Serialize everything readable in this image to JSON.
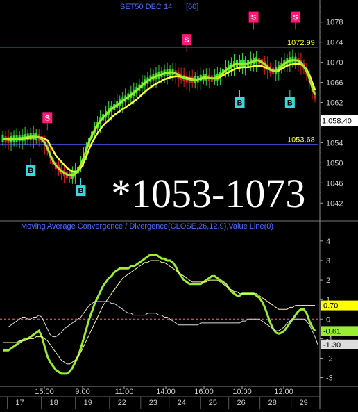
{
  "chart_data": [
    {
      "type": "line",
      "title": "SET50 DEC 14",
      "interval": "[60]",
      "ylim": [
        1039,
        1081
      ],
      "yticks": [
        1042,
        1046,
        1050,
        1054,
        1058,
        1062,
        1066,
        1070,
        1074,
        1078
      ],
      "grid": false,
      "annotation_text": "*1053-1073",
      "reference_lines": [
        {
          "value": 1072.99,
          "label": "1072.99",
          "color": "#4d5bff"
        },
        {
          "value": 1053.68,
          "label": "1053.68",
          "color": "#4d5bff"
        }
      ],
      "last_price": {
        "value": 1058.4,
        "label": "1,058.40"
      },
      "signals": [
        {
          "type": "buy",
          "label": "B",
          "bar": 10,
          "price": 1051.0
        },
        {
          "type": "sell",
          "label": "S",
          "bar": 16,
          "price": 1056.5
        },
        {
          "type": "buy",
          "label": "B",
          "bar": 28,
          "price": 1047.0
        },
        {
          "type": "sell",
          "label": "S",
          "bar": 66,
          "price": 1072.0
        },
        {
          "type": "buy",
          "label": "B",
          "bar": 85,
          "price": 1064.5
        },
        {
          "type": "sell",
          "label": "S",
          "bar": 90,
          "price": 1076.5
        },
        {
          "type": "buy",
          "label": "B",
          "bar": 103,
          "price": 1064.5
        },
        {
          "type": "sell",
          "label": "S",
          "bar": 105,
          "price": 1076.5
        }
      ],
      "series": [
        {
          "name": "",
          "color": "#ffff33",
          "values": [
            1054.8,
            1054.8,
            1054.7,
            1054.7,
            1054.7,
            1054.8,
            1054.8,
            1054.8,
            1054.9,
            1054.9,
            1055.0,
            1055.0,
            1055.1,
            1055.1,
            1055.0,
            1054.8,
            1054.5,
            1053.5,
            1052.5,
            1051.5,
            1050.8,
            1050.2,
            1049.6,
            1049.0,
            1048.6,
            1048.3,
            1048.2,
            1048.4,
            1049.0,
            1050.0,
            1051.3,
            1052.8,
            1054.0,
            1055.0,
            1055.9,
            1056.7,
            1057.4,
            1058.0,
            1058.5,
            1059.0,
            1059.5,
            1059.9,
            1060.3,
            1060.7,
            1061.0,
            1061.4,
            1061.8,
            1062.2,
            1062.6,
            1063.1,
            1063.6,
            1064.1,
            1064.6,
            1065.0,
            1065.4,
            1065.7,
            1066.0,
            1066.3,
            1066.6,
            1066.8,
            1067.0,
            1067.1,
            1067.2,
            1067.2,
            1067.1,
            1067.0,
            1066.9,
            1066.8,
            1066.7,
            1066.6,
            1066.6,
            1066.7,
            1066.8,
            1066.8,
            1066.8,
            1066.8,
            1066.8,
            1066.9,
            1067.1,
            1067.4,
            1067.7,
            1068.0,
            1068.3,
            1068.6,
            1068.8,
            1068.9,
            1069.0,
            1069.0,
            1069.0,
            1069.1,
            1069.2,
            1069.3,
            1069.3,
            1069.2,
            1069.0,
            1068.8,
            1068.5,
            1068.3,
            1068.2,
            1068.4,
            1068.7,
            1069.0,
            1069.3,
            1069.5,
            1069.6,
            1069.7,
            1069.7,
            1069.6,
            1069.2,
            1068.6,
            1067.5,
            1066.0,
            1064.5
          ]
        },
        {
          "name": "",
          "color": "#99ee33",
          "values": [
            1054.8,
            1054.7,
            1054.6,
            1054.6,
            1054.7,
            1054.8,
            1054.9,
            1054.9,
            1055.0,
            1055.1,
            1055.2,
            1055.2,
            1055.2,
            1055.1,
            1054.7,
            1054.0,
            1053.0,
            1051.6,
            1050.4,
            1049.5,
            1048.9,
            1048.4,
            1048.0,
            1047.7,
            1047.5,
            1047.5,
            1047.8,
            1048.5,
            1049.6,
            1051.0,
            1052.6,
            1054.2,
            1055.5,
            1056.6,
            1057.5,
            1058.3,
            1059.0,
            1059.6,
            1060.2,
            1060.7,
            1061.1,
            1061.5,
            1061.9,
            1062.3,
            1062.7,
            1063.1,
            1063.5,
            1063.9,
            1064.4,
            1064.9,
            1065.4,
            1065.9,
            1066.3,
            1066.7,
            1067.0,
            1067.2,
            1067.4,
            1067.6,
            1067.8,
            1067.9,
            1068.0,
            1068.0,
            1067.8,
            1067.5,
            1067.2,
            1066.9,
            1066.7,
            1066.6,
            1066.5,
            1066.5,
            1066.6,
            1066.8,
            1067.0,
            1067.0,
            1066.9,
            1066.8,
            1066.8,
            1067.0,
            1067.4,
            1067.9,
            1068.4,
            1068.8,
            1069.2,
            1069.5,
            1069.7,
            1069.7,
            1069.7,
            1069.7,
            1069.8,
            1070.0,
            1070.2,
            1070.4,
            1070.3,
            1070.0,
            1069.6,
            1069.1,
            1068.6,
            1068.3,
            1068.3,
            1068.7,
            1069.2,
            1069.7,
            1070.1,
            1070.3,
            1070.4,
            1070.4,
            1070.3,
            1069.9,
            1069.2,
            1068.2,
            1066.8,
            1065.0,
            1063.5
          ]
        }
      ]
    },
    {
      "type": "line",
      "title": "Moving Average Convergence / Divergence(CLOSE,26,12,9),Value Line(0)",
      "ylim": [
        -3.3,
        4.6
      ],
      "yticks": [
        -3,
        -2,
        -1,
        0,
        1,
        2,
        3,
        4
      ],
      "zero_line": 0,
      "value_labels": [
        {
          "value": 0.7,
          "label": "0.70",
          "bg": "#ffff00",
          "fg": "#000000"
        },
        {
          "value": -0.61,
          "label": "-0.61",
          "bg": "#99ee33",
          "fg": "#000000"
        },
        {
          "value": -1.3,
          "label": "-1.30",
          "bg": "#dddddd",
          "fg": "#000000"
        }
      ],
      "series": [
        {
          "name": "",
          "color": "#99ee33",
          "values": [
            -1.6,
            -1.6,
            -1.6,
            -1.5,
            -1.4,
            -1.3,
            -1.2,
            -1.1,
            -1.0,
            -1.0,
            -0.9,
            -0.8,
            -0.7,
            -0.6,
            -0.9,
            -1.4,
            -1.9,
            -2.2,
            -2.4,
            -2.6,
            -2.7,
            -2.8,
            -2.8,
            -2.8,
            -2.7,
            -2.5,
            -2.2,
            -1.9,
            -1.5,
            -1.0,
            -0.5,
            0.0,
            0.4,
            0.8,
            1.1,
            1.4,
            1.7,
            1.9,
            2.1,
            2.2,
            2.4,
            2.5,
            2.6,
            2.6,
            2.6,
            2.6,
            2.7,
            2.7,
            2.8,
            2.9,
            3.0,
            3.1,
            3.2,
            3.3,
            3.3,
            3.3,
            3.2,
            3.1,
            3.1,
            3.0,
            3.0,
            2.9,
            2.7,
            2.4,
            2.2,
            2.0,
            1.9,
            1.8,
            1.8,
            1.8,
            1.8,
            1.8,
            1.9,
            2.0,
            2.1,
            2.2,
            2.2,
            2.1,
            2.0,
            1.9,
            1.8,
            1.6,
            1.4,
            1.3,
            1.2,
            1.2,
            1.3,
            1.3,
            1.3,
            1.3,
            1.3,
            1.2,
            1.1,
            0.9,
            0.6,
            0.2,
            -0.2,
            -0.5,
            -0.7,
            -0.75,
            -0.7,
            -0.6,
            -0.4,
            -0.2,
            0.0,
            0.2,
            0.4,
            0.5,
            0.5,
            0.3,
            -0.1,
            -0.4,
            -0.61
          ]
        },
        {
          "name": "",
          "color": "#ffff99",
          "values": [
            -1.2,
            -1.2,
            -1.2,
            -1.2,
            -1.2,
            -1.2,
            -1.1,
            -1.1,
            -1.1,
            -1.0,
            -1.0,
            -1.0,
            -0.9,
            -0.9,
            -0.9,
            -1.0,
            -1.1,
            -1.3,
            -1.5,
            -1.7,
            -1.9,
            -2.1,
            -2.2,
            -2.3,
            -2.3,
            -2.2,
            -2.1,
            -1.9,
            -1.7,
            -1.4,
            -1.1,
            -0.8,
            -0.5,
            -0.2,
            0.1,
            0.4,
            0.7,
            0.9,
            1.1,
            1.3,
            1.5,
            1.7,
            1.9,
            2.1,
            2.2,
            2.3,
            2.4,
            2.5,
            2.6,
            2.7,
            2.8,
            2.9,
            2.9,
            3.0,
            3.0,
            3.0,
            3.0,
            2.9,
            2.9,
            2.8,
            2.7,
            2.6,
            2.5,
            2.4,
            2.3,
            2.2,
            2.1,
            2.0,
            1.9,
            1.9,
            1.9,
            1.9,
            1.9,
            1.9,
            2.0,
            2.0,
            2.0,
            2.0,
            1.9,
            1.8,
            1.7,
            1.6,
            1.5,
            1.4,
            1.4,
            1.3,
            1.3,
            1.3,
            1.3,
            1.3,
            1.3,
            1.3,
            1.2,
            1.1,
            1.0,
            0.9,
            0.8,
            0.7,
            0.6,
            0.5,
            0.5,
            0.5,
            0.5,
            0.6,
            0.6,
            0.7,
            0.7,
            0.7,
            0.7,
            0.7,
            0.7,
            0.7,
            0.7
          ]
        },
        {
          "name": "",
          "color": "#dddddd",
          "values": [
            -0.4,
            -0.4,
            -0.4,
            -0.3,
            -0.2,
            -0.1,
            0.0,
            0.1,
            0.1,
            0.0,
            0.0,
            0.1,
            0.1,
            0.2,
            0.1,
            -0.2,
            -0.5,
            -0.8,
            -0.9,
            -0.9,
            -0.8,
            -0.7,
            -0.5,
            -0.4,
            -0.3,
            -0.2,
            -0.1,
            0.0,
            0.1,
            0.3,
            0.5,
            0.7,
            0.8,
            0.9,
            0.9,
            0.9,
            0.9,
            0.9,
            0.9,
            0.8,
            0.8,
            0.7,
            0.6,
            0.5,
            0.4,
            0.3,
            0.3,
            0.2,
            0.2,
            0.2,
            0.2,
            0.2,
            0.3,
            0.3,
            0.3,
            0.3,
            0.2,
            0.2,
            0.1,
            0.1,
            0.0,
            -0.1,
            -0.2,
            -0.3,
            -0.3,
            -0.3,
            -0.3,
            -0.3,
            -0.3,
            -0.3,
            -0.3,
            -0.2,
            -0.2,
            -0.2,
            -0.2,
            -0.2,
            -0.2,
            -0.2,
            -0.2,
            -0.2,
            -0.2,
            -0.2,
            -0.2,
            -0.2,
            -0.2,
            -0.2,
            -0.1,
            -0.1,
            0.0,
            0.0,
            0.0,
            0.0,
            0.0,
            -0.1,
            -0.2,
            -0.3,
            -0.4,
            -0.5,
            -0.6,
            -0.6,
            -0.5,
            -0.4,
            -0.2,
            -0.1,
            0.0,
            0.0,
            0.0,
            0.0,
            0.0,
            -0.1,
            -0.3,
            -0.6,
            -0.9,
            -1.3
          ]
        }
      ]
    }
  ],
  "x_axis": {
    "time_labels": [
      {
        "label": "15:00",
        "bar": 12
      },
      {
        "label": "9:00",
        "bar": 23
      },
      {
        "label": "11:00",
        "bar": 35
      },
      {
        "label": "14:00",
        "bar": 47
      },
      {
        "label": "16:00",
        "bar": 58
      },
      {
        "label": "10:00",
        "bar": 69
      },
      {
        "label": "12:00",
        "bar": 81
      }
    ],
    "date_labels": [
      {
        "label": "17",
        "bar": 6
      },
      {
        "label": "18",
        "bar": 18
      },
      {
        "label": "19",
        "bar": 30
      },
      {
        "label": "22",
        "bar": 42
      },
      {
        "label": "23",
        "bar": 53
      },
      {
        "label": "24",
        "bar": 63
      },
      {
        "label": "25",
        "bar": 74
      },
      {
        "label": "26",
        "bar": 84
      },
      {
        "label": "28",
        "bar": 95
      },
      {
        "label": "29",
        "bar": 106
      }
    ]
  },
  "colors": {
    "background": "#000000",
    "axis_text": "#cccccc",
    "title_text": "#4d6bff",
    "buy": "#33dddd",
    "sell": "#ff1a75",
    "candle_up": "#33dd33",
    "candle_down": "#dd2222",
    "zero_line": "#ff6666"
  }
}
